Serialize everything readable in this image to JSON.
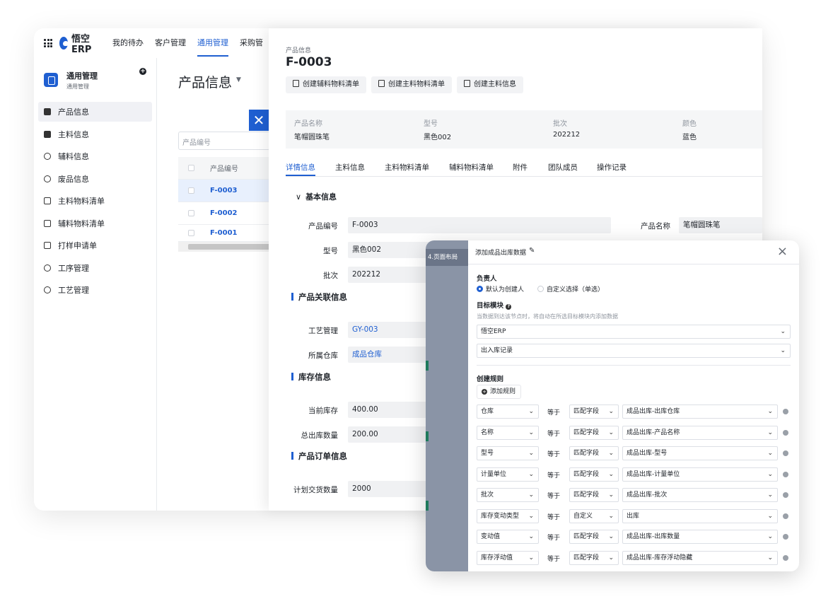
{
  "app": {
    "logo_text": "悟空ERP",
    "nav": [
      "我的待办",
      "客户管理",
      "通用管理",
      "采购管"
    ],
    "active_nav": 2
  },
  "sidebar": {
    "title": "通用管理",
    "subtitle": "通用管理",
    "items": [
      {
        "label": "产品信息",
        "icon": "document-filled-icon"
      },
      {
        "label": "主料信息",
        "icon": "document-filled-icon"
      },
      {
        "label": "辅料信息",
        "icon": "gear-icon"
      },
      {
        "label": "废品信息",
        "icon": "gear-icon"
      },
      {
        "label": "主料物料清单",
        "icon": "checklist-icon"
      },
      {
        "label": "辅料物料清单",
        "icon": "checklist-icon"
      },
      {
        "label": "打样申请单",
        "icon": "checklist-icon"
      },
      {
        "label": "工序管理",
        "icon": "process-icon"
      },
      {
        "label": "工艺管理",
        "icon": "process-icon"
      }
    ]
  },
  "list": {
    "title": "产品信息",
    "search_placeholder": "产品编号",
    "column": "产品编号",
    "rows": [
      "F-0003",
      "F-0002",
      "F-0001"
    ]
  },
  "detail": {
    "crumb": "产品信息",
    "code": "F-0003",
    "buttons": [
      "创建辅料物料清单",
      "创建主料物料清单",
      "创建主料信息"
    ],
    "summary": [
      {
        "label": "产品名称",
        "value": "笔帽圆珠笔"
      },
      {
        "label": "型号",
        "value": "黑色002"
      },
      {
        "label": "批次",
        "value": "202212"
      },
      {
        "label": "颜色",
        "value": "蓝色"
      }
    ],
    "tabs": [
      "详情信息",
      "主料信息",
      "主料物料清单",
      "辅料物料清单",
      "附件",
      "团队成员",
      "操作记录"
    ],
    "basic_section": "基本信息",
    "fields": {
      "code_label": "产品编号",
      "code_value": "F-0003",
      "name_label": "产品名称",
      "name_value": "笔帽圆珠笔",
      "model_label": "型号",
      "model_value": "黑色002",
      "batch_label": "批次",
      "batch_value": "202212"
    },
    "sec_related": "产品关联信息",
    "process_label": "工艺管理",
    "process_value": "GY-003",
    "warehouse_label": "所属仓库",
    "warehouse_value": "成品仓库",
    "sec_stock": "库存信息",
    "stock_label": "当前库存",
    "stock_value": "400.00",
    "out_label": "总出库数量",
    "out_value": "200.00",
    "sec_order": "产品订单信息",
    "plan_label": "计划交货数量",
    "plan_value": "2000"
  },
  "modal": {
    "side_label": "4.页面布局",
    "title": "添加成品出库数据",
    "owner_label": "负责人",
    "owner_opt1": "默认为创建人",
    "owner_opt2": "自定义选择（单选）",
    "target_label": "目标模块",
    "target_note": "当数据到达该节点时，将自动在所选目标模块内添加数据",
    "target_app": "悟空ERP",
    "target_module": "出入库记录",
    "rules_label": "创建规则",
    "add_rule": "添加规则",
    "eq": "等于",
    "rules": [
      {
        "field": "仓库",
        "mode": "匹配字段",
        "value": "成品出库-出库仓库"
      },
      {
        "field": "名称",
        "mode": "匹配字段",
        "value": "成品出库-产品名称"
      },
      {
        "field": "型号",
        "mode": "匹配字段",
        "value": "成品出库-型号"
      },
      {
        "field": "计量单位",
        "mode": "匹配字段",
        "value": "成品出库-计量单位"
      },
      {
        "field": "批次",
        "mode": "匹配字段",
        "value": "成品出库-批次"
      },
      {
        "field": "库存变动类型",
        "mode": "自定义",
        "value": "出库"
      },
      {
        "field": "变动值",
        "mode": "匹配字段",
        "value": "成品出库-出库数量"
      },
      {
        "field": "库存浮动值",
        "mode": "匹配字段",
        "value": "成品出库-库存浮动隐藏"
      }
    ]
  },
  "colors": {
    "accent": "#1f5fd1"
  }
}
